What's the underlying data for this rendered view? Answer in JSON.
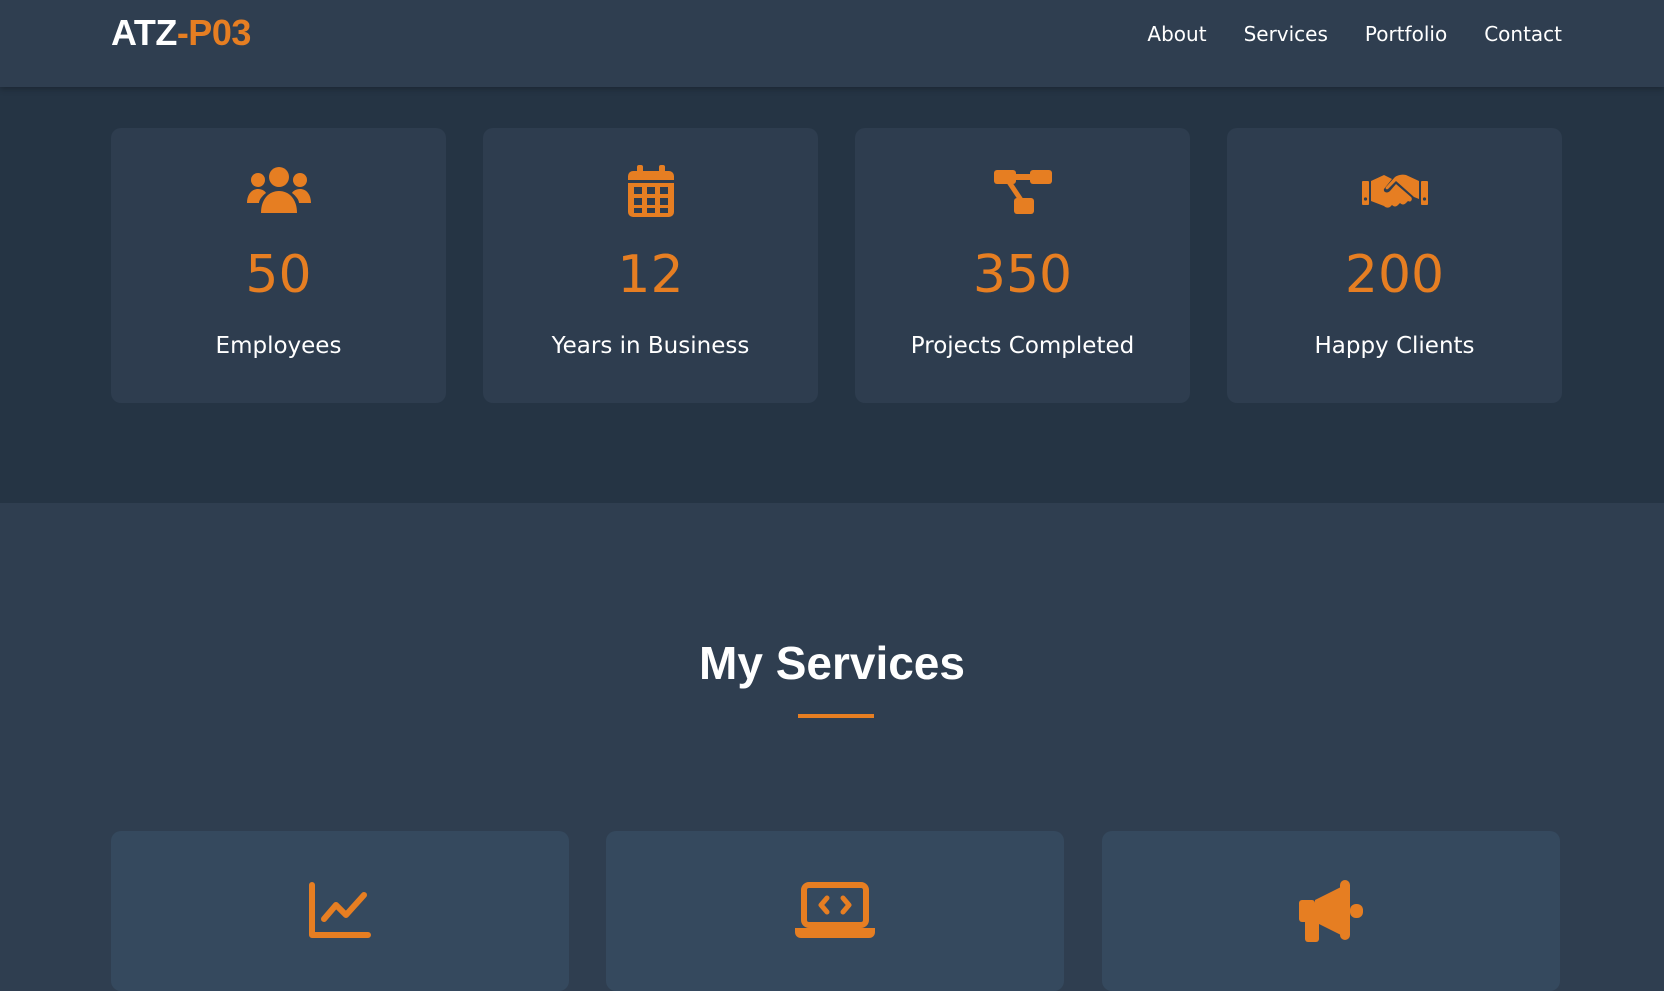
{
  "header": {
    "logo_main": "ATZ",
    "logo_accent": "-P03",
    "nav": [
      {
        "label": "About"
      },
      {
        "label": "Services"
      },
      {
        "label": "Portfolio"
      },
      {
        "label": "Contact"
      }
    ]
  },
  "stats": [
    {
      "icon": "users-icon",
      "value": "50",
      "label": "Employees"
    },
    {
      "icon": "calendar-icon",
      "value": "12",
      "label": "Years in Business"
    },
    {
      "icon": "project-diagram-icon",
      "value": "350",
      "label": "Projects Completed"
    },
    {
      "icon": "handshake-icon",
      "value": "200",
      "label": "Happy Clients"
    }
  ],
  "services": {
    "title": "My Services",
    "cards": [
      {
        "icon": "chart-line-icon"
      },
      {
        "icon": "laptop-code-icon"
      },
      {
        "icon": "megaphone-icon"
      }
    ]
  },
  "colors": {
    "accent": "#e67e22",
    "navbar_bg": "#2f3e50",
    "stats_bg": "#253444",
    "card_bg": "#2e3d4f",
    "service_card_bg": "#35495e",
    "text": "#ffffff"
  }
}
